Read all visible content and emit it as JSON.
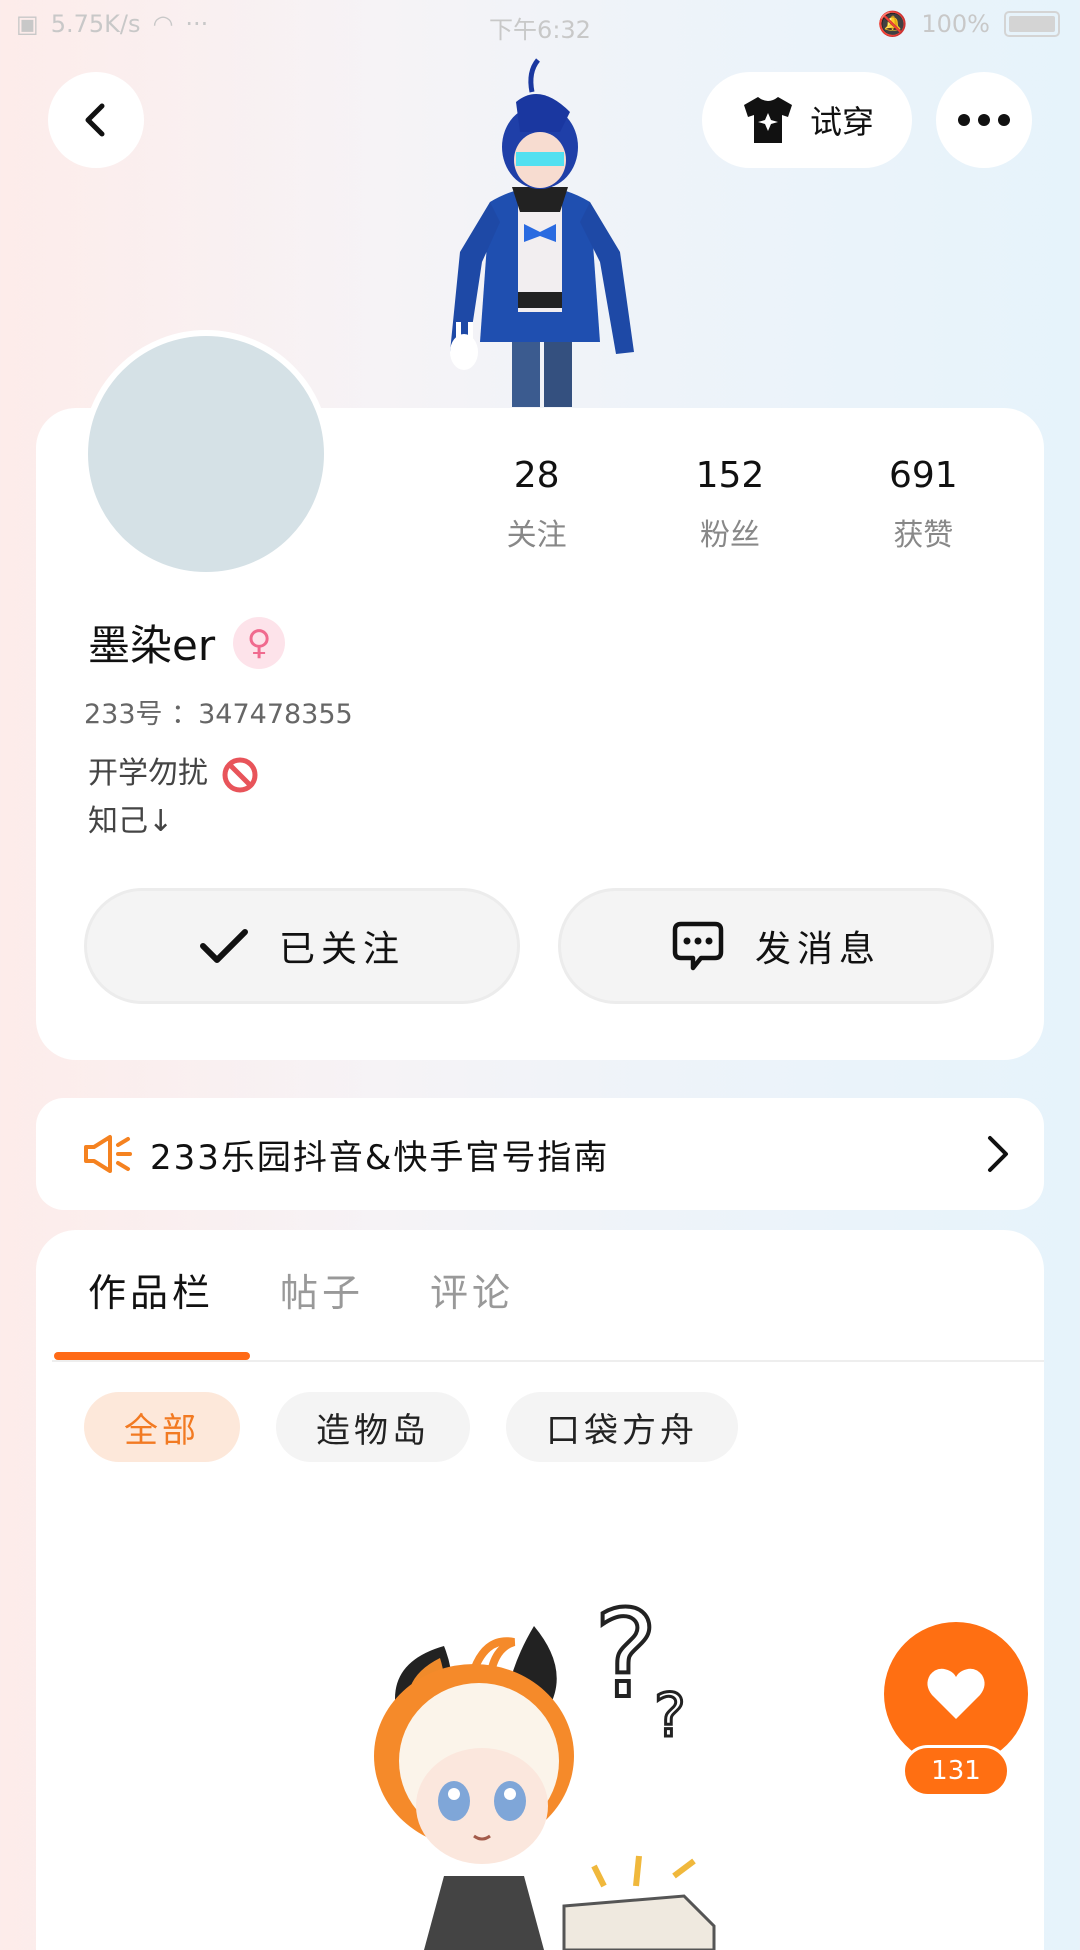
{
  "status_bar": {
    "speed": "5.75K/s",
    "time": "下午6:32",
    "battery": "100%"
  },
  "header": {
    "tryon_label": "试穿"
  },
  "profile": {
    "stats": [
      {
        "value": "28",
        "label": "关注"
      },
      {
        "value": "152",
        "label": "粉丝"
      },
      {
        "value": "691",
        "label": "获赞"
      }
    ],
    "name": "墨染er",
    "gender_symbol": "♀",
    "uid": "233号 ：347478355",
    "bio_line1": "开学勿扰",
    "bio_line2": "知己↓",
    "follow_label": "已关注",
    "message_label": "发消息"
  },
  "notice": {
    "text": "233乐园抖音&快手官号指南"
  },
  "works": {
    "tabs": [
      {
        "label": "作品栏"
      },
      {
        "label": "帖子"
      },
      {
        "label": "评论"
      }
    ],
    "filters": [
      {
        "label": "全部"
      },
      {
        "label": "造物岛"
      },
      {
        "label": "口袋方舟"
      }
    ]
  },
  "like": {
    "count": "131"
  },
  "colors": {
    "accent": "#ff6f12",
    "chip_active_bg": "#fde8da",
    "avatar_bg": "#d5e1e6"
  }
}
